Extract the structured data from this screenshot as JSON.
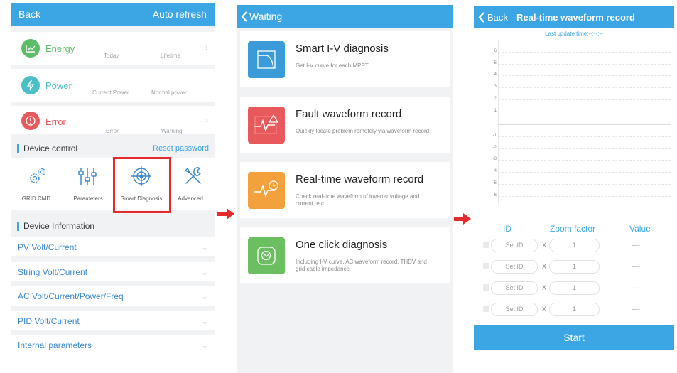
{
  "screen1": {
    "back": "Back",
    "auto_refresh": "Auto refresh",
    "metrics": [
      {
        "title": "Energy",
        "sub1": "Today",
        "sub2": "Lifetime",
        "color": "#5cbd66"
      },
      {
        "title": "Power",
        "sub1": "Current Power",
        "sub2": "Normal power",
        "color": "#4bbfc6"
      },
      {
        "title": "Error",
        "sub1": "Error",
        "sub2": "Warning",
        "color": "#e9595b"
      }
    ],
    "device_control": "Device control",
    "reset_password": "Reset password",
    "tools": [
      "GRID CMD",
      "Parameters",
      "Smart Diagnosis",
      "Advanced"
    ],
    "device_information": "Device Information",
    "info_rows": [
      "PV Volt/Current",
      "String Volt/Current",
      "AC Volt/Current/Power/Freq",
      "PID Volt/Current",
      "Internal parameters"
    ],
    "highlight_color": "#e52b2b"
  },
  "screen2": {
    "back": "Waiting",
    "cards": [
      {
        "title": "Smart I-V diagnosis",
        "desc": "Get I-V curve for each MPPT.",
        "color": "#3b9ad8",
        "icon": "iv-curve-icon"
      },
      {
        "title": "Fault waveform record",
        "desc": "Quickly locate problem remotely via waveform record.",
        "color": "#e8595b",
        "icon": "fault-waveform-icon"
      },
      {
        "title": "Real-time waveform record",
        "desc": "Check real-time waveform of inverter voltage and current, etc.",
        "color": "#f2a13c",
        "icon": "realtime-waveform-icon"
      },
      {
        "title": "One click diagnosis",
        "desc": "Including I-V curve, AC waveform record, THDV and grid cable impedance .",
        "color": "#6cbf61",
        "icon": "one-click-diagnosis-icon"
      }
    ]
  },
  "screen3": {
    "back": "Back",
    "title": "Real-time waveform record",
    "last_update": "Last update time:--:--:--",
    "y_ticks": [
      "6",
      "5",
      "4",
      "3",
      "2",
      "1",
      "-1",
      "-2",
      "-3",
      "-4",
      "-5",
      "-6"
    ],
    "columns": {
      "id": "ID",
      "zoom": "Zoom factor",
      "value": "Value"
    },
    "rows": [
      {
        "id": "Set ID",
        "x": "X",
        "zoom": "1",
        "value": "----"
      },
      {
        "id": "Set ID",
        "x": "X",
        "zoom": "1",
        "value": "----"
      },
      {
        "id": "Set ID",
        "x": "X",
        "zoom": "1",
        "value": "----"
      },
      {
        "id": "Set ID",
        "x": "X",
        "zoom": "1",
        "value": "----"
      }
    ],
    "start": "Start"
  },
  "arrow_color": "#e52b2b"
}
